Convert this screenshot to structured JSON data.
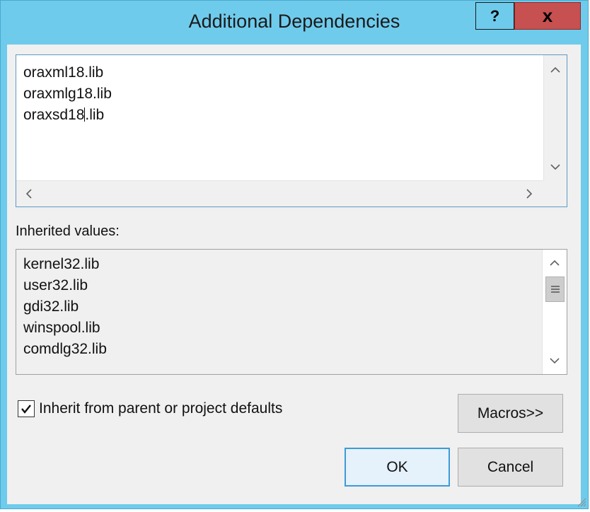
{
  "dialog": {
    "title": "Additional Dependencies",
    "help_label": "?",
    "close_label": "x"
  },
  "editor": {
    "lines": [
      "oraxml18.lib",
      "oraxmlg18.lib",
      "oraxsd18"
    ],
    "caret_tail": ".lib"
  },
  "inherited": {
    "label": "Inherited values:",
    "items": [
      "kernel32.lib",
      "user32.lib",
      "gdi32.lib",
      "winspool.lib",
      "comdlg32.lib"
    ]
  },
  "inherit_checkbox": {
    "label": "Inherit from parent or project defaults",
    "checked": true
  },
  "buttons": {
    "macros": "Macros>>",
    "ok": "OK",
    "cancel": "Cancel"
  },
  "icons": [
    "help-icon",
    "close-icon",
    "chevron-up-icon",
    "chevron-down-icon",
    "chevron-left-icon",
    "chevron-right-icon",
    "checkmark-icon",
    "resize-grip-icon"
  ]
}
